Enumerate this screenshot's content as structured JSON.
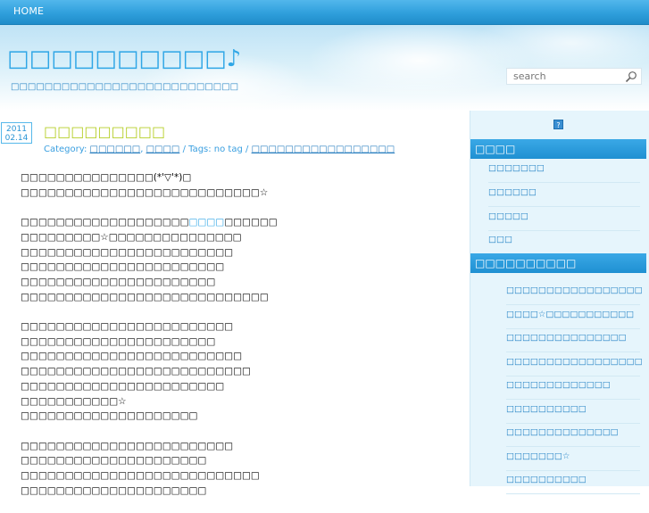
{
  "nav": {
    "home": "HOME"
  },
  "header": {
    "title": "□□□□□□□□□□♪",
    "description": "□□□□□□□□□□□□□□□□□□□□□□□□□□□"
  },
  "search": {
    "placeholder": "search"
  },
  "post": {
    "year": "2011",
    "date": "02.14",
    "title": "□□□□□□□□□",
    "meta": {
      "category_label": "Category:",
      "categories": [
        "□□□□□□",
        "□□□□"
      ],
      "tags_label": "/ Tags: no tag /",
      "comments": "□□□□□□□□□□□□□□□□□"
    },
    "paragraphs": [
      [
        "□□□□□□□□□□□□□□□(*'▽'*)□",
        "□□□□□□□□□□□□□□□□□□□□□□□□□□□☆"
      ],
      [
        "□□□□□□□□□□□□□□□□□□□",
        "□□□□",
        "□□□□□□",
        "□□□□□□□□□☆□□□□□□□□□□□□□□□",
        "□□□□□□□□□□□□□□□□□□□□□□□□",
        "□□□□□□□□□□□□□□□□□□□□□□□",
        "□□□□□□□□□□□□□□□□□□□□□□",
        "□□□□□□□□□□□□□□□□□□□□□□□□□□□□"
      ],
      [
        "□□□□□□□□□□□□□□□□□□□□□□□□",
        "□□□□□□□□□□□□□□□□□□□□□□",
        "□□□□□□□□□□□□□□□□□□□□□□□□□",
        "□□□□□□□□□□□□□□□□□□□□□□□□□□",
        "□□□□□□□□□□□□□□□□□□□□□□□",
        "□□□□□□□□□□□☆",
        "□□□□□□□□□□□□□□□□□□□□"
      ],
      [
        "□□□□□□□□□□□□□□□□□□□□□□□□",
        "□□□□□□□□□□□□□□□□□□□□□",
        "□□□□□□□□□□□□□□□□□□□□□□□□□□□",
        "□□□□□□□□□□□□□□□□□□□□□"
      ]
    ]
  },
  "sidebar": {
    "badge": "?",
    "section1": {
      "title": "□□□□",
      "items": [
        "□□□□□□□",
        "□□□□□□",
        "□□□□□",
        "□□□"
      ]
    },
    "section2": {
      "title": "□□□□□□□□□□",
      "items": [
        "□□□□□□□□□□□□□□□□□",
        "□□□□☆□□□□□□□□□□□",
        "□□□□□□□□□□□□□□□",
        "□□□□□□□□□□□□□□□□□",
        "□□□□□□□□□□□□□",
        "□□□□□□□□□□",
        "□□□□□□□□□□□□□□",
        "□□□□□□□☆",
        "□□□□□□□□□□"
      ]
    }
  },
  "colors": {
    "nav_bar": "#2f9fdc",
    "title": "#2fa6e6",
    "post_title": "#b7cf2a",
    "sidebar_bg": "#e6f5fc",
    "sidebar_head": "#1f90d2"
  }
}
